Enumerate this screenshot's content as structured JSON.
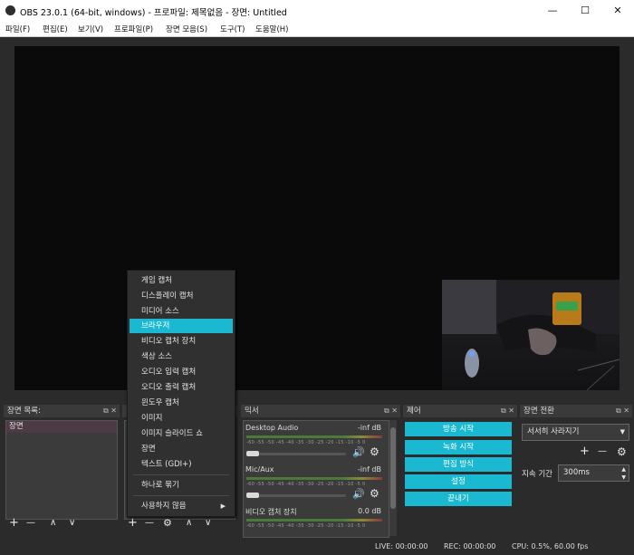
{
  "window": {
    "title": "OBS 23.0.1 (64-bit, windows) - 프로파일: 제목없음 - 장면: Untitled",
    "minimize_glyph": "—",
    "maximize_glyph": "☐",
    "close_glyph": "✕"
  },
  "menu": [
    "파일(F)",
    "편집(E)",
    "보기(V)",
    "프로파일(P)",
    "장면 모음(S)",
    "도구(T)",
    "도움말(H)"
  ],
  "docks": {
    "scenes": {
      "title": "장면 목록:",
      "items": [
        "장면"
      ],
      "toolbar": [
        "+",
        "—",
        "∧",
        "∨"
      ]
    },
    "sources": {
      "toolbar": [
        "+",
        "—",
        "⚙",
        "∧",
        "∨"
      ]
    },
    "mixer": {
      "title": "믹서",
      "channels": [
        {
          "name": "Desktop Audio",
          "level": "-inf dB"
        },
        {
          "name": "Mic/Aux",
          "level": "-inf dB"
        },
        {
          "name": "비디오 캡처 장치",
          "level": "0.0 dB"
        }
      ],
      "ticks": "-60 -55 -50 -45 -40 -35 -30 -25 -20 -15 -10 -5 0"
    },
    "controls": {
      "title": "제어",
      "buttons": [
        "방송 시작",
        "녹화 시작",
        "편집 방식",
        "설정",
        "끝내기"
      ]
    },
    "transitions": {
      "title": "장면 전환",
      "selected": "서서히 사라지기",
      "duration_label": "지속 기간",
      "duration_value": "300ms"
    }
  },
  "context_menu": {
    "items": [
      "게임 캡처",
      "디스플레이 캡처",
      "미디어 소스",
      "브라우저",
      "비디오 캡처 장치",
      "색상 소스",
      "오디오 입력 캡처",
      "오디오 출력 캡처",
      "윈도우 캡처",
      "이미지",
      "이미지 슬라이드 쇼",
      "장면",
      "텍스트 (GDI+)"
    ],
    "selected": "브라우저",
    "group": "하나로 묶기",
    "deprecated": "사용하지 않음"
  },
  "status": {
    "live": "LIVE: 00:00:00",
    "rec": "REC: 00:00:00",
    "cpu": "CPU: 0.5%, 60.00 fps"
  },
  "colors": {
    "accent": "#1ab9d1",
    "scene_selected": "#4d3a45"
  }
}
